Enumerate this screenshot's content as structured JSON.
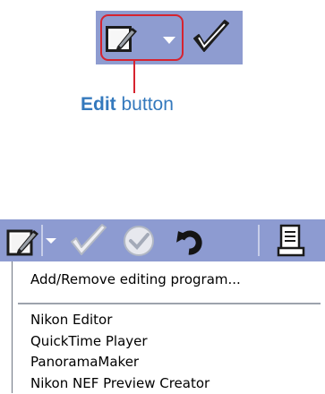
{
  "callout": {
    "label_bold": "Edit",
    "label_rest": " button",
    "highlight_color": "#d6232f",
    "label_color": "#3479bd"
  },
  "toolbar": {
    "background": "#8d9bd1",
    "buttons": [
      {
        "name": "edit",
        "icon": "edit-pencil-icon"
      },
      {
        "name": "edit-dropdown",
        "icon": "chevron-down-icon"
      },
      {
        "name": "check",
        "icon": "checkmark-icon"
      },
      {
        "name": "ok",
        "icon": "ok-circle-icon"
      },
      {
        "name": "undo",
        "icon": "undo-arrow-icon"
      },
      {
        "name": "document",
        "icon": "document-icon"
      }
    ]
  },
  "menu": {
    "add_remove": "Add/Remove editing program...",
    "items": [
      "Nikon Editor",
      "QuickTime Player",
      "PanoramaMaker",
      "Nikon NEF Preview Creator"
    ]
  }
}
